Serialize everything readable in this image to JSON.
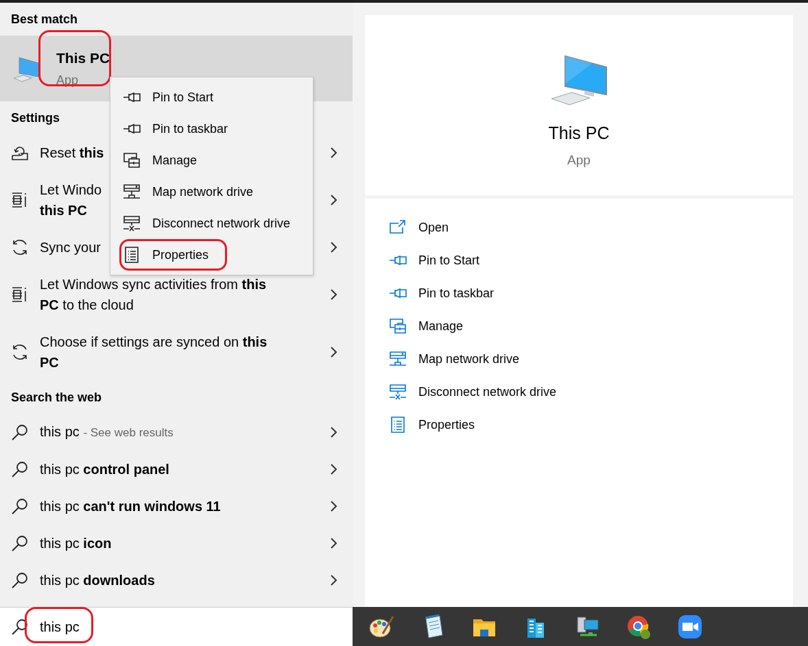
{
  "best_match": {
    "header": "Best match",
    "title": "This PC",
    "subtitle": "App",
    "selected": true,
    "circled": true
  },
  "settings": {
    "header": "Settings",
    "items": [
      {
        "kind": "reset",
        "lines": [
          "Reset **this**"
        ]
      },
      {
        "kind": "timeline",
        "lines": [
          "Let Windo",
          "**this PC**"
        ]
      },
      {
        "kind": "sync",
        "lines": [
          "Sync your"
        ]
      },
      {
        "kind": "timeline",
        "lines": [
          "Let Windows sync activities from **this**",
          "**PC** to the cloud"
        ]
      },
      {
        "kind": "sync",
        "lines": [
          "Choose if settings are synced on **this**",
          "**PC**"
        ]
      }
    ]
  },
  "web": {
    "header": "Search the web",
    "items": [
      {
        "text": "this pc",
        "note": "- See web results"
      },
      {
        "text": "this pc **control panel**"
      },
      {
        "text": "this pc **can't run windows 11**"
      },
      {
        "text": "this pc **icon**"
      },
      {
        "text": "this pc **downloads**"
      }
    ]
  },
  "context_menu": {
    "items": [
      {
        "kind": "pin",
        "label": "Pin to Start",
        "circled": false
      },
      {
        "kind": "pin",
        "label": "Pin to taskbar",
        "circled": false
      },
      {
        "kind": "manage",
        "label": "Manage",
        "circled": false
      },
      {
        "kind": "map",
        "label": "Map network drive",
        "circled": false
      },
      {
        "kind": "disconnect",
        "label": "Disconnect network drive",
        "circled": false
      },
      {
        "kind": "properties",
        "label": "Properties",
        "circled": true
      }
    ]
  },
  "preview": {
    "title": "This PC",
    "subtitle": "App",
    "actions": [
      {
        "kind": "open",
        "label": "Open"
      },
      {
        "kind": "pin",
        "label": "Pin to Start"
      },
      {
        "kind": "pin",
        "label": "Pin to taskbar"
      },
      {
        "kind": "manage",
        "label": "Manage"
      },
      {
        "kind": "map",
        "label": "Map network drive"
      },
      {
        "kind": "disconnect",
        "label": "Disconnect network drive"
      },
      {
        "kind": "properties",
        "label": "Properties"
      }
    ]
  },
  "search": {
    "value": "this pc",
    "circled": true
  },
  "taskbar": {
    "apps": [
      {
        "kind": "paint"
      },
      {
        "kind": "notepad"
      },
      {
        "kind": "folder"
      },
      {
        "kind": "buildings"
      },
      {
        "kind": "network"
      },
      {
        "kind": "browser"
      },
      {
        "kind": "video"
      }
    ]
  }
}
